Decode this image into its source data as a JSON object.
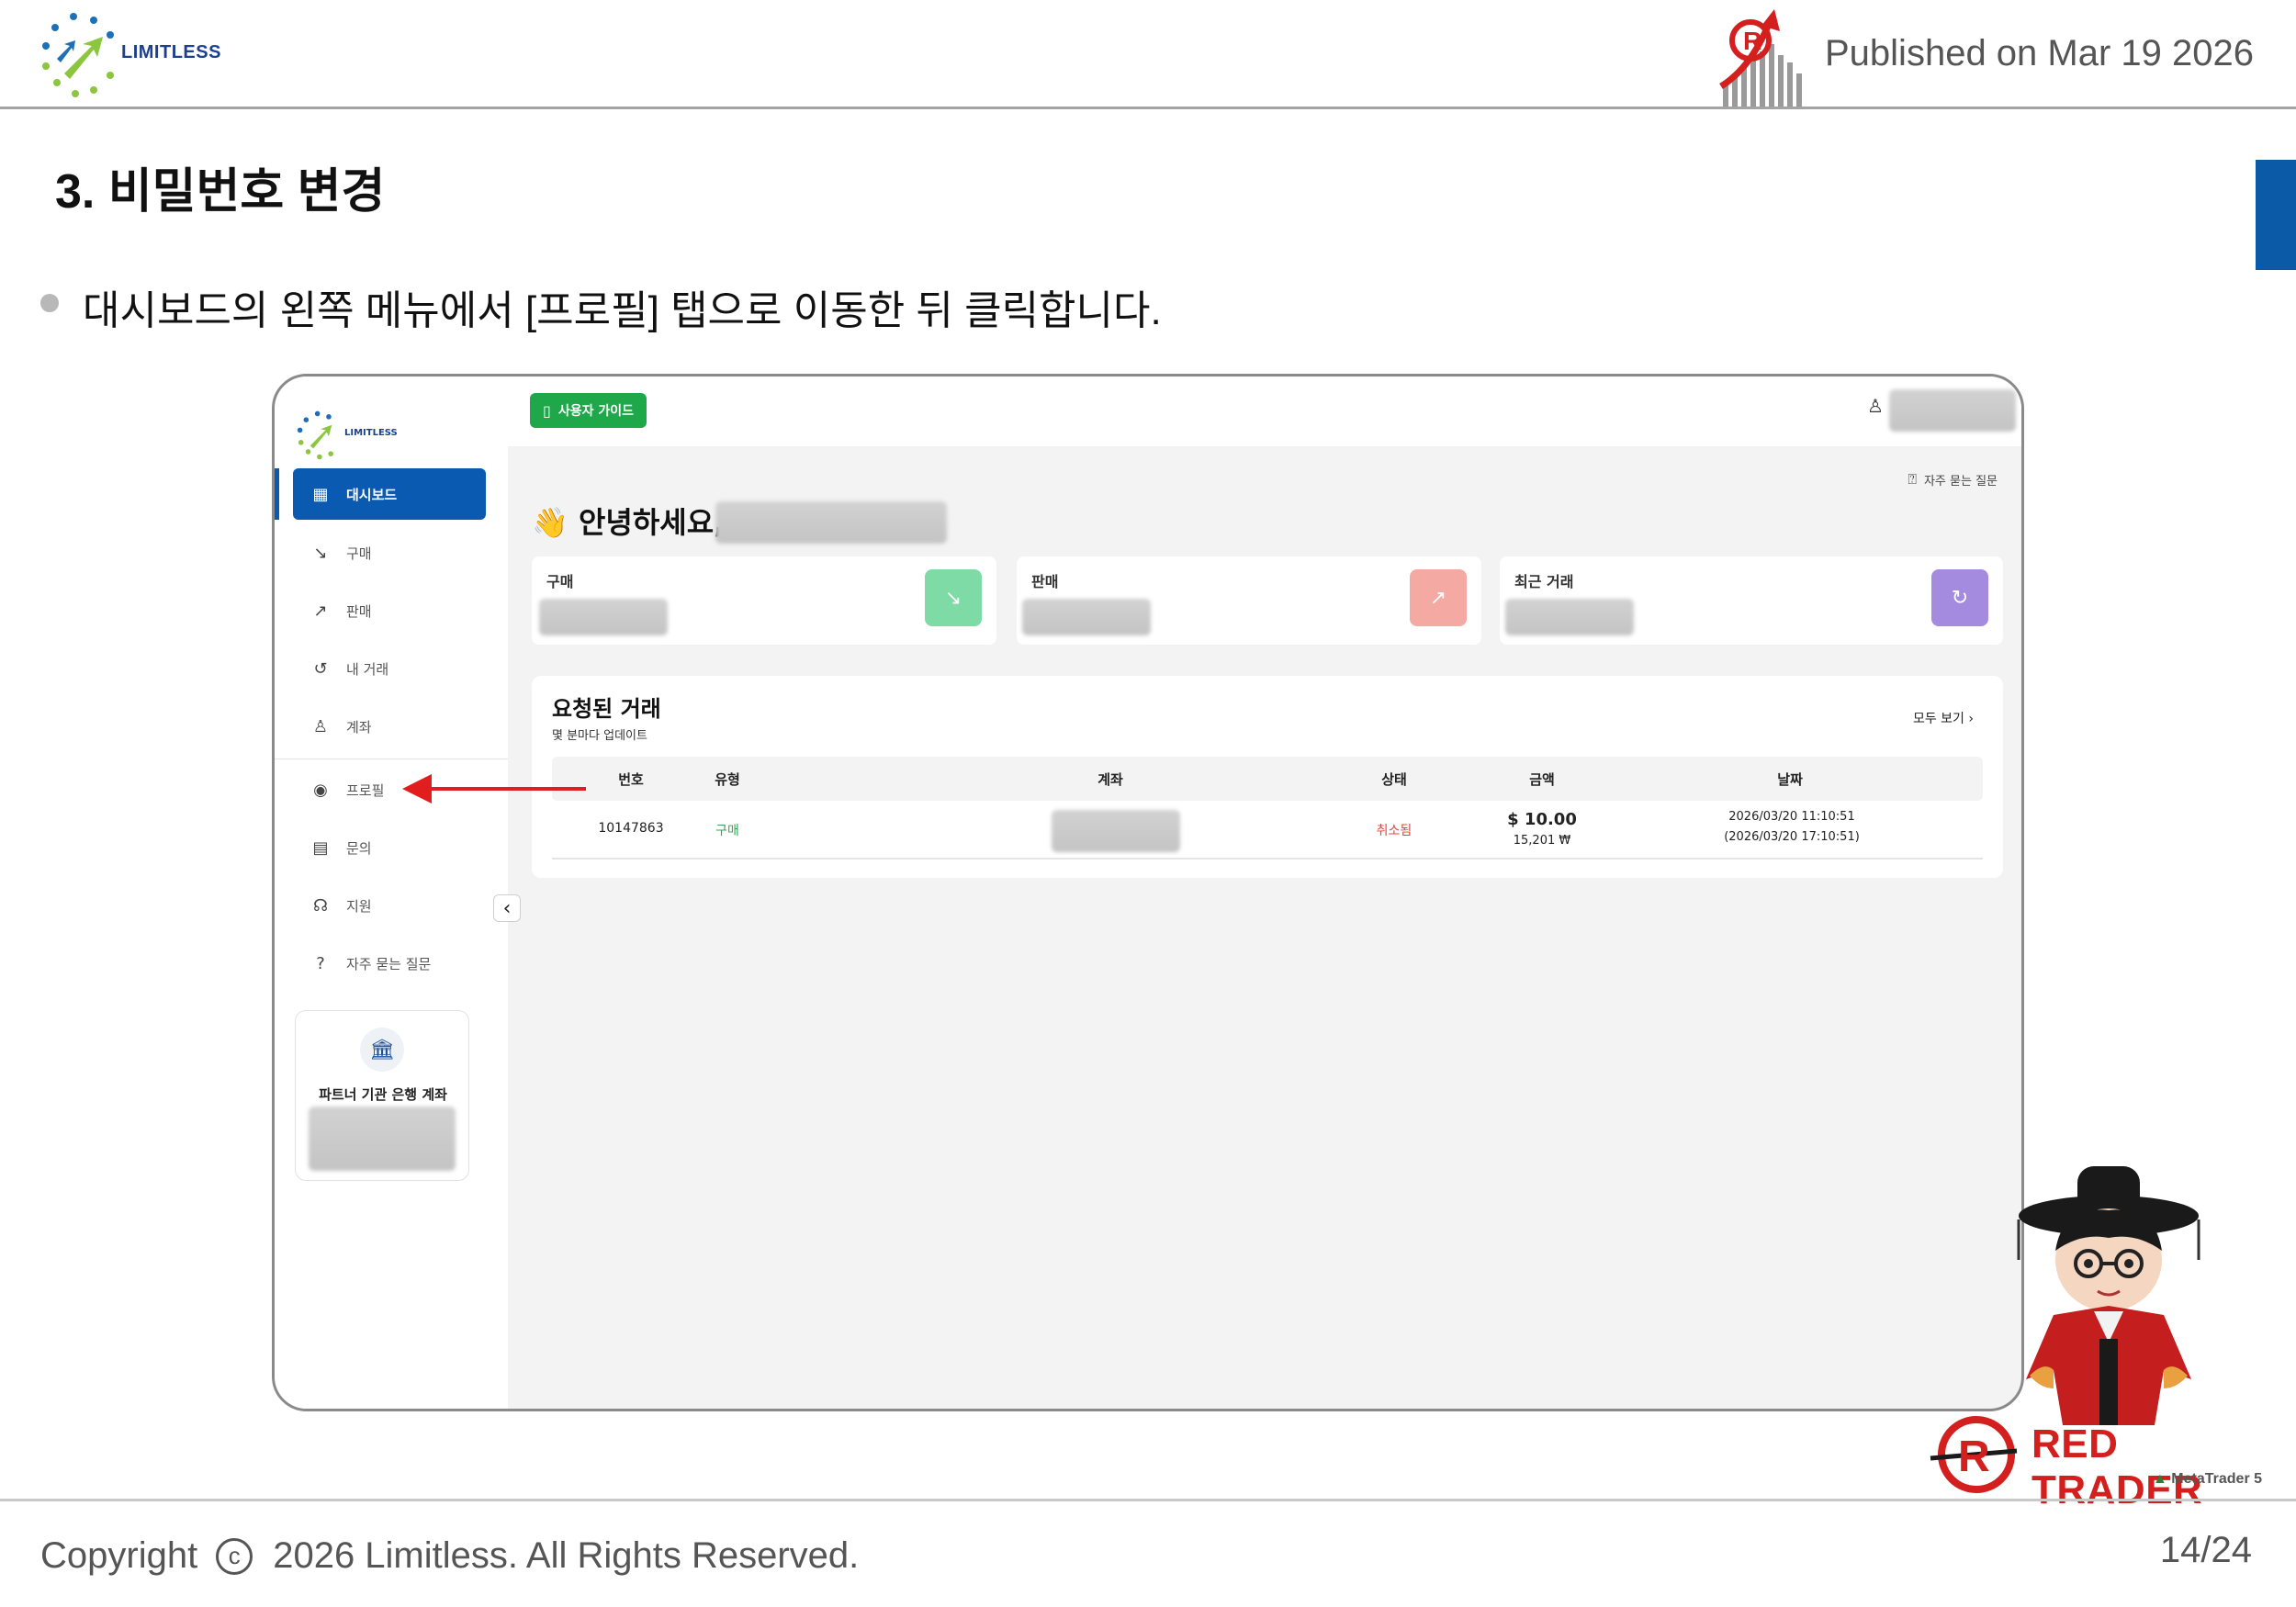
{
  "slide": {
    "logo_text": "LIMITLESS",
    "published": "Published on Mar 19 2026",
    "heading": "3. 비밀번호 변경",
    "bullet": "대시보드의 왼쪽 메뉴에서 [프로필] 탭으로 이동한 뒤 클릭합니다.",
    "copyright_prefix": "Copyright",
    "copyright_rest": "2026 Limitless. All Rights Reserved.",
    "page_num": "14/24",
    "brand": "RED TRADER",
    "brand_sub_prefix": "Meta",
    "brand_sub_rest": "Trader 5"
  },
  "app": {
    "logo_text": "LIMITLESS",
    "guide_button": "사용자 가이드",
    "sidebar": {
      "items": [
        {
          "label": "대시보드",
          "icon": "grid-icon"
        },
        {
          "label": "구매",
          "icon": "arrow-down-right-icon"
        },
        {
          "label": "판매",
          "icon": "arrow-up-right-icon"
        },
        {
          "label": "내 거래",
          "icon": "history-icon"
        },
        {
          "label": "계좌",
          "icon": "user-plus-icon"
        },
        {
          "label": "프로필",
          "icon": "profile-icon"
        },
        {
          "label": "문의",
          "icon": "chat-icon"
        },
        {
          "label": "지원",
          "icon": "headset-icon"
        },
        {
          "label": "자주 묻는 질문",
          "icon": "help-icon"
        }
      ],
      "partner_card_label": "파트너 기관 은행 계좌"
    },
    "faq_link": "자주 묻는 질문",
    "greeting": "안녕하세요,",
    "cards": [
      {
        "label": "구매",
        "color": "#7fdba6"
      },
      {
        "label": "판매",
        "color": "#f4a9a3"
      },
      {
        "label": "최근 거래",
        "color": "#a58be0"
      }
    ],
    "requests": {
      "title": "요청된 거래",
      "subtitle": "몇 분마다 업데이트",
      "view_all": "모두 보기",
      "columns": [
        "번호",
        "유형",
        "계좌",
        "상태",
        "금액",
        "날짜"
      ],
      "rows": [
        {
          "id": "10147863",
          "type": "구매",
          "status": "취소됨",
          "amount": "$ 10.00",
          "amount_krw": "15,201 ₩",
          "date": "2026/03/20 11:10:51",
          "date_local": "(2026/03/20 17:10:51)"
        }
      ]
    }
  },
  "colors": {
    "primary": "#0b5ab2",
    "guide_green": "#1ea84a",
    "buy_green": "#2eaa55",
    "cancel_red": "#e0463c",
    "arrow_red": "#e11d1d"
  }
}
